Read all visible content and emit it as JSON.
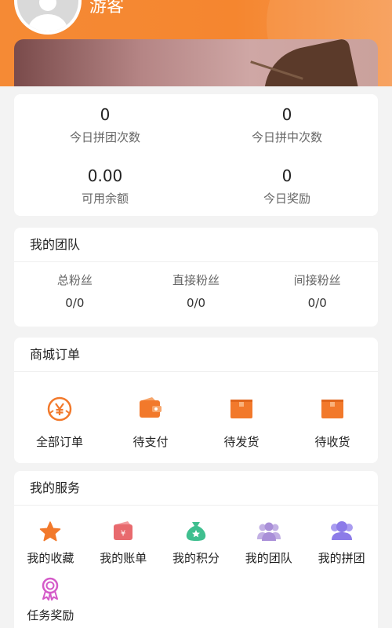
{
  "user": {
    "name": "游客"
  },
  "stats": [
    {
      "value": "0",
      "label": "今日拼团次数"
    },
    {
      "value": "0",
      "label": "今日拼中次数"
    },
    {
      "value": "0.00",
      "label": "可用余额"
    },
    {
      "value": "0",
      "label": "今日奖励"
    }
  ],
  "team": {
    "title": "我的团队",
    "cols": [
      {
        "label": "总粉丝",
        "value": "0/0"
      },
      {
        "label": "直接粉丝",
        "value": "0/0"
      },
      {
        "label": "间接粉丝",
        "value": "0/0"
      }
    ]
  },
  "orders": {
    "title": "商城订单",
    "items": [
      {
        "label": "全部订单",
        "icon": "yen-coin-icon"
      },
      {
        "label": "待支付",
        "icon": "wallet-icon"
      },
      {
        "label": "待发货",
        "icon": "box-icon"
      },
      {
        "label": "待收货",
        "icon": "box-icon"
      }
    ]
  },
  "services": {
    "title": "我的服务",
    "items": [
      {
        "label": "我的收藏",
        "icon": "star-icon",
        "color": "#f2792b"
      },
      {
        "label": "我的账单",
        "icon": "bill-icon",
        "color": "#e86a6e"
      },
      {
        "label": "我的积分",
        "icon": "money-bag-icon",
        "color": "#3fbf8f"
      },
      {
        "label": "我的团队",
        "icon": "group-icon",
        "color": "#a98fd8"
      },
      {
        "label": "我的拼团",
        "icon": "team-icon",
        "color": "#8c7be8"
      },
      {
        "label": "任务奖励",
        "icon": "medal-icon",
        "color": "#d45ac8"
      }
    ]
  },
  "colors": {
    "accent": "#f58a35"
  }
}
